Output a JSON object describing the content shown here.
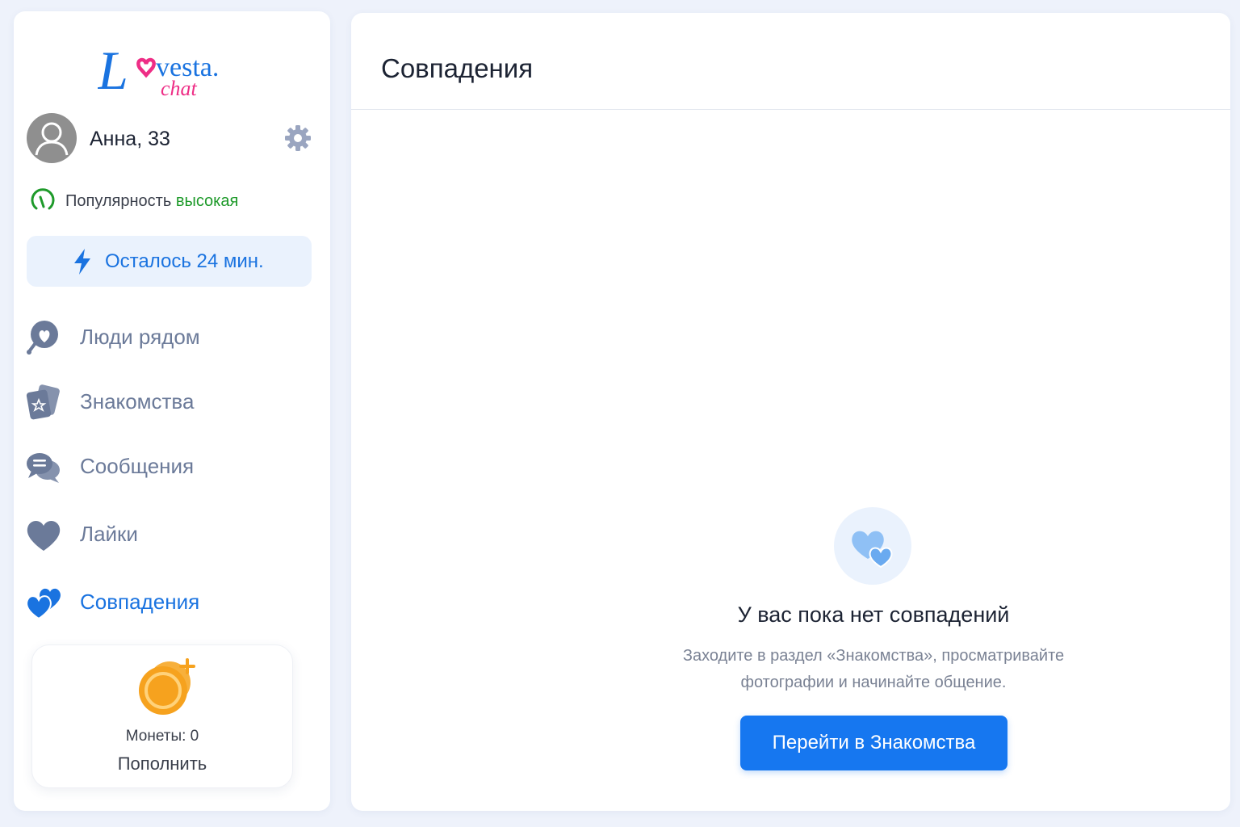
{
  "brand": {
    "logo_main": "vesta.",
    "logo_sub": "chat",
    "logo_letter": "L",
    "colors": {
      "primary": "#1a73e0",
      "accent": "#ee2e86"
    }
  },
  "profile": {
    "name": "Анна, 33",
    "avatar_icon": "user-avatar-icon",
    "settings_icon": "gear-icon"
  },
  "popularity": {
    "label": "Популярность",
    "value": "высокая",
    "value_color": "#1e9a2a"
  },
  "boost": {
    "text": "Осталось 24 мин.",
    "icon": "lightning-icon"
  },
  "nav": {
    "items": [
      {
        "label": "Люди рядом",
        "icon": "location-heart-icon"
      },
      {
        "label": "Знакомства",
        "icon": "cards-icon"
      },
      {
        "label": "Сообщения",
        "icon": "chat-bubbles-icon"
      },
      {
        "label": "Лайки",
        "icon": "heart-icon"
      },
      {
        "label": "Совпадения",
        "icon": "double-heart-icon",
        "active": true
      }
    ]
  },
  "coins": {
    "count_text": "Монеты: 0",
    "topup_label": "Пополнить",
    "icon": "coins-icon"
  },
  "main": {
    "title": "Совпадения",
    "empty": {
      "title": "У вас пока нет совпадений",
      "desc_line1": "Заходите в раздел «Знакомства», просматривайте",
      "desc_line2": "фотографии и начинайте общение.",
      "button": "Перейти в Знакомства"
    }
  }
}
